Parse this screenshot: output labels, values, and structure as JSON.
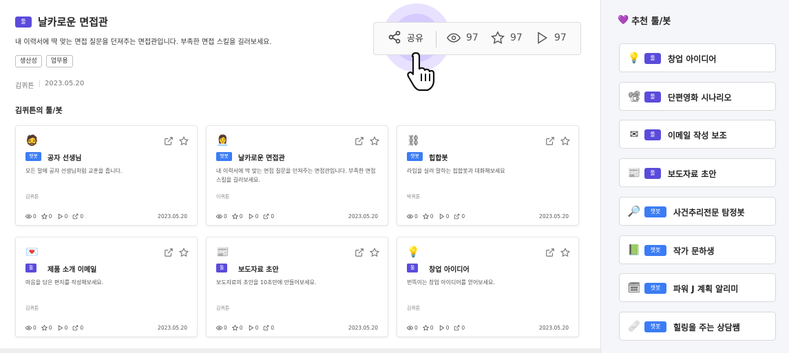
{
  "header": {
    "badge": "툴",
    "title": "날카로운 면접관",
    "description": "내 이력서에 딱 맞는 면접 질문을 던져주는 면접관입니다. 부족한 면접 스킬을 길러보세요.",
    "tags": [
      "생산성",
      "업무용"
    ],
    "author": "김퀴튼",
    "date": "2023.05.20"
  },
  "actions": {
    "share_label": "공유",
    "views": "97",
    "stars": "97",
    "plays": "97"
  },
  "section_title": "김퀴튼의 툴/봇",
  "cards": [
    {
      "emoji": "🧔",
      "badge": "챗봇",
      "badge_type": "chatbot",
      "title": "공자 선생님",
      "desc": "모든 말에 공자 선생님처럼 교훈을 줍니다.",
      "author": "김퀴튼",
      "views": "0",
      "stars": "0",
      "plays": "0",
      "shares": "0",
      "date": "2023.05.20"
    },
    {
      "emoji": "👩‍💼",
      "badge": "챗봇",
      "badge_type": "chatbot",
      "title": "날카로운 면접관",
      "desc": "내 이력서에 딱 맞는 면접 질문을 던져주는 면접관입니다. 부족한 면접 스킬을 길러보세요.",
      "author": "이퀴튼",
      "views": "0",
      "stars": "0",
      "plays": "0",
      "shares": "0",
      "date": "2023.05.20"
    },
    {
      "emoji": "⛓",
      "badge": "챗봇",
      "badge_type": "chatbot",
      "title": "힙합봇",
      "desc": "라임을 실려 말하는 힙합봇과 대화해보세요",
      "author": "박퀴튼",
      "views": "0",
      "stars": "0",
      "plays": "0",
      "shares": "0",
      "date": "2023.05.20"
    },
    {
      "emoji": "💌",
      "badge": "툴",
      "badge_type": "tool",
      "title": "제품 소개 이메일",
      "desc": "마음을 담은 편지를 작성해보세요.",
      "author": "김퀴튼",
      "views": "0",
      "stars": "0",
      "plays": "0",
      "shares": "0",
      "date": "2023.05.20"
    },
    {
      "emoji": "📰",
      "badge": "툴",
      "badge_type": "tool",
      "title": "보도자료 초안",
      "desc": "보도자료의 초안을 10초만에 만들어보세요.",
      "author": "김퀴튼",
      "views": "0",
      "stars": "0",
      "plays": "0",
      "shares": "0",
      "date": "2023.05.20"
    },
    {
      "emoji": "💡",
      "badge": "툴",
      "badge_type": "tool",
      "title": "창업 아이디어",
      "desc": "번뜩이는 창업 아이디어를 얻어보세요.",
      "author": "김퀴튼",
      "views": "0",
      "stars": "0",
      "plays": "0",
      "shares": "0",
      "date": "2023.05.20"
    }
  ],
  "sidebar": {
    "title_emoji": "💜",
    "title": "추천 툴/봇",
    "items": [
      {
        "emoji": "💡",
        "badge": "툴",
        "badge_type": "tool",
        "label": "창업 아이디어"
      },
      {
        "emoji": "📽",
        "badge": "툴",
        "badge_type": "tool",
        "label": "단편영화 시나리오"
      },
      {
        "emoji": "✉",
        "badge": "툴",
        "badge_type": "tool",
        "label": "이메일 작성 보조"
      },
      {
        "emoji": "📰",
        "badge": "툴",
        "badge_type": "tool",
        "label": "보도자료 초안"
      },
      {
        "emoji": "🔎",
        "badge": "챗봇",
        "badge_type": "chatbot",
        "label": "사건추리전문 탐정봇"
      },
      {
        "emoji": "📗",
        "badge": "챗봇",
        "badge_type": "chatbot",
        "label": "작가 문하생"
      },
      {
        "emoji": "🗓",
        "badge": "챗봇",
        "badge_type": "chatbot",
        "label": "파워 J 계획 알리미"
      },
      {
        "emoji": "🩹",
        "badge": "챗봇",
        "badge_type": "chatbot",
        "label": "힐링을 주는 상담쌤"
      }
    ]
  },
  "colors": {
    "tool_badge": "#5b4bdb",
    "chatbot_badge": "#3b7cf5",
    "sidebar_bg": "#f5f6fa"
  }
}
